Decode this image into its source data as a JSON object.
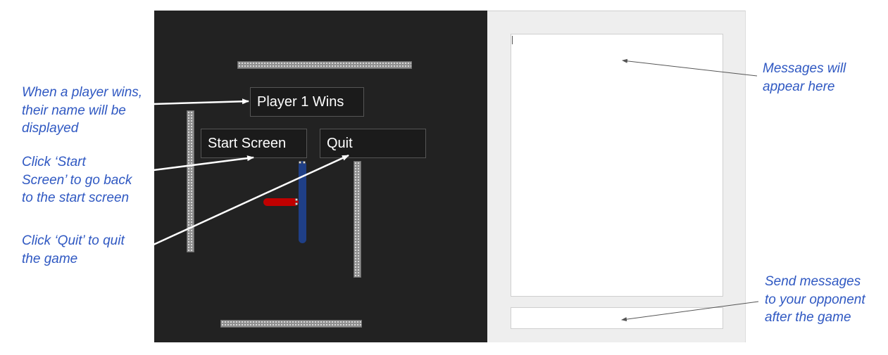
{
  "game": {
    "banner_text": "Player 1 Wins",
    "start_screen_label": "Start Screen",
    "quit_label": "Quit",
    "colors": {
      "background": "#222222",
      "player_blue": "#1f3f86",
      "player_red": "#c00000",
      "wall": "#8f8f8f"
    }
  },
  "chat": {
    "messages_placeholder": "",
    "input_placeholder": ""
  },
  "annotations": {
    "winner_note": "When a player wins,\ntheir name will be\ndisplayed",
    "start_note": "Click ‘Start\nScreen’ to go back\nto the start screen",
    "quit_note": "Click ‘Quit’ to quit\nthe game",
    "messages_note": "Messages will\nappear here",
    "send_note": "Send messages\nto your opponent\nafter the game",
    "color": "#2f58c2"
  }
}
